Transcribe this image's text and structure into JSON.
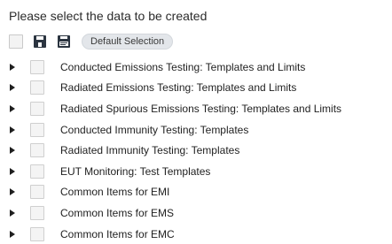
{
  "header": {
    "prompt": "Please select the data to be created"
  },
  "toolbar": {
    "select_all_checked": false,
    "icons": [
      "save-icon",
      "save-as-icon"
    ],
    "default_selection_label": "Default Selection"
  },
  "tree": {
    "items": [
      {
        "label": "Conducted Emissions Testing: Templates and Limits",
        "checked": false,
        "expanded": false
      },
      {
        "label": "Radiated Emissions Testing: Templates and Limits",
        "checked": false,
        "expanded": false
      },
      {
        "label": "Radiated Spurious Emissions Testing: Templates and Limits",
        "checked": false,
        "expanded": false
      },
      {
        "label": "Conducted Immunity Testing: Templates",
        "checked": false,
        "expanded": false
      },
      {
        "label": "Radiated Immunity Testing: Templates",
        "checked": false,
        "expanded": false
      },
      {
        "label": "EUT Monitoring: Test Templates",
        "checked": false,
        "expanded": false
      },
      {
        "label": "Common Items for EMI",
        "checked": false,
        "expanded": false
      },
      {
        "label": "Common Items for EMS",
        "checked": false,
        "expanded": false
      },
      {
        "label": "Common Items for EMC",
        "checked": false,
        "expanded": false
      }
    ]
  },
  "colors": {
    "text": "#1f1f1f",
    "icon_dark": "#2b3440",
    "button_bg": "#e3e6ea",
    "checkbox_bg": "#f4f4f4",
    "checkbox_border": "#cfcfcf"
  }
}
